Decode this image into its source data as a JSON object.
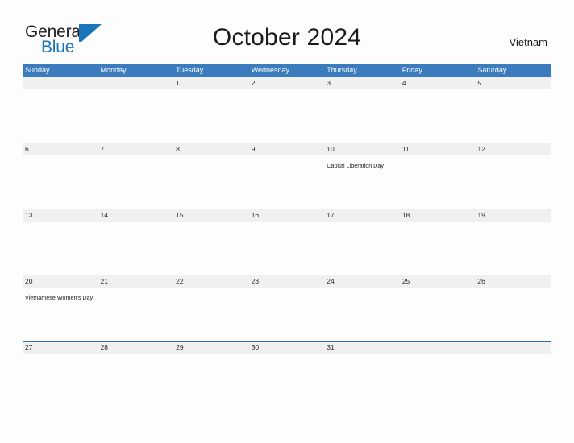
{
  "brand": {
    "name_part1": "General",
    "name_part2": "Blue",
    "flag_icon": "blue-flag-triangle"
  },
  "header": {
    "title": "October 2024",
    "country": "Vietnam"
  },
  "calendar": {
    "weekdays": [
      "Sunday",
      "Monday",
      "Tuesday",
      "Wednesday",
      "Thursday",
      "Friday",
      "Saturday"
    ],
    "header_bg": "#3a7cbe",
    "row_border": "#2f6ea8",
    "date_band_bg": "#f0f0f0",
    "weeks": [
      {
        "days": [
          {
            "num": "",
            "event": ""
          },
          {
            "num": "",
            "event": ""
          },
          {
            "num": "1",
            "event": ""
          },
          {
            "num": "2",
            "event": ""
          },
          {
            "num": "3",
            "event": ""
          },
          {
            "num": "4",
            "event": ""
          },
          {
            "num": "5",
            "event": ""
          }
        ]
      },
      {
        "days": [
          {
            "num": "6",
            "event": ""
          },
          {
            "num": "7",
            "event": ""
          },
          {
            "num": "8",
            "event": ""
          },
          {
            "num": "9",
            "event": ""
          },
          {
            "num": "10",
            "event": "Capital Liberation Day"
          },
          {
            "num": "11",
            "event": ""
          },
          {
            "num": "12",
            "event": ""
          }
        ]
      },
      {
        "days": [
          {
            "num": "13",
            "event": ""
          },
          {
            "num": "14",
            "event": ""
          },
          {
            "num": "15",
            "event": ""
          },
          {
            "num": "16",
            "event": ""
          },
          {
            "num": "17",
            "event": ""
          },
          {
            "num": "18",
            "event": ""
          },
          {
            "num": "19",
            "event": ""
          }
        ]
      },
      {
        "days": [
          {
            "num": "20",
            "event": "Vietnamese Women's Day"
          },
          {
            "num": "21",
            "event": ""
          },
          {
            "num": "22",
            "event": ""
          },
          {
            "num": "23",
            "event": ""
          },
          {
            "num": "24",
            "event": ""
          },
          {
            "num": "25",
            "event": ""
          },
          {
            "num": "26",
            "event": ""
          }
        ]
      },
      {
        "days": [
          {
            "num": "27",
            "event": ""
          },
          {
            "num": "28",
            "event": ""
          },
          {
            "num": "29",
            "event": ""
          },
          {
            "num": "30",
            "event": ""
          },
          {
            "num": "31",
            "event": ""
          },
          {
            "num": "",
            "event": ""
          },
          {
            "num": "",
            "event": ""
          }
        ]
      }
    ]
  }
}
